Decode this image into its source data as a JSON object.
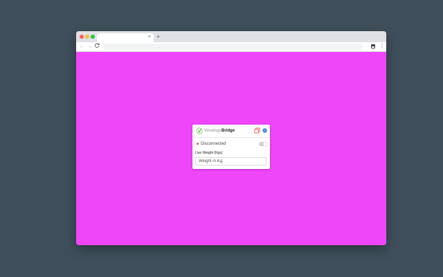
{
  "browser": {
    "tab_close": "×",
    "new_tab": "+",
    "nav": {
      "back": "←",
      "forward": "→",
      "reload": "C"
    },
    "menu": "⋮"
  },
  "popup": {
    "brand_primary": "Vesatogo",
    "brand_secondary": "Bridge",
    "status": "Disconnected",
    "status_color": "#e8574b",
    "connection_toggle_on": false,
    "weight_label": "Live Weight (Kgs)",
    "weight_placeholder": "Weight in Kg.",
    "icons": [
      "window-icon",
      "gear-icon"
    ],
    "accent": "#1a73c8",
    "window_icon_color": "#e8574b"
  },
  "page_background": "#f046fa"
}
